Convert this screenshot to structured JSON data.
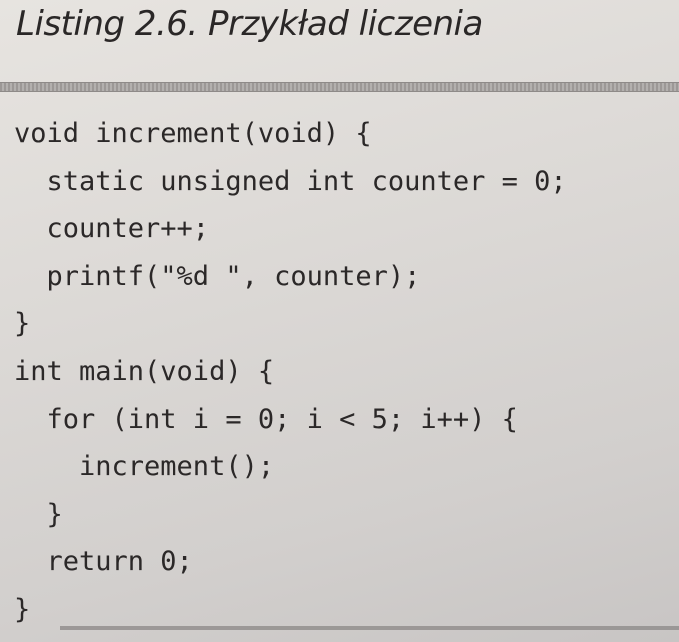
{
  "listing": {
    "title": "Listing 2.6. Przykład liczenia",
    "code_lines": [
      "void increment(void) {",
      "  static unsigned int counter = 0;",
      "  counter++;",
      "  printf(\"%d \", counter);",
      "}",
      "int main(void) {",
      "  for (int i = 0; i < 5; i++) {",
      "    increment();",
      "  }",
      "  return 0;",
      "}"
    ]
  }
}
